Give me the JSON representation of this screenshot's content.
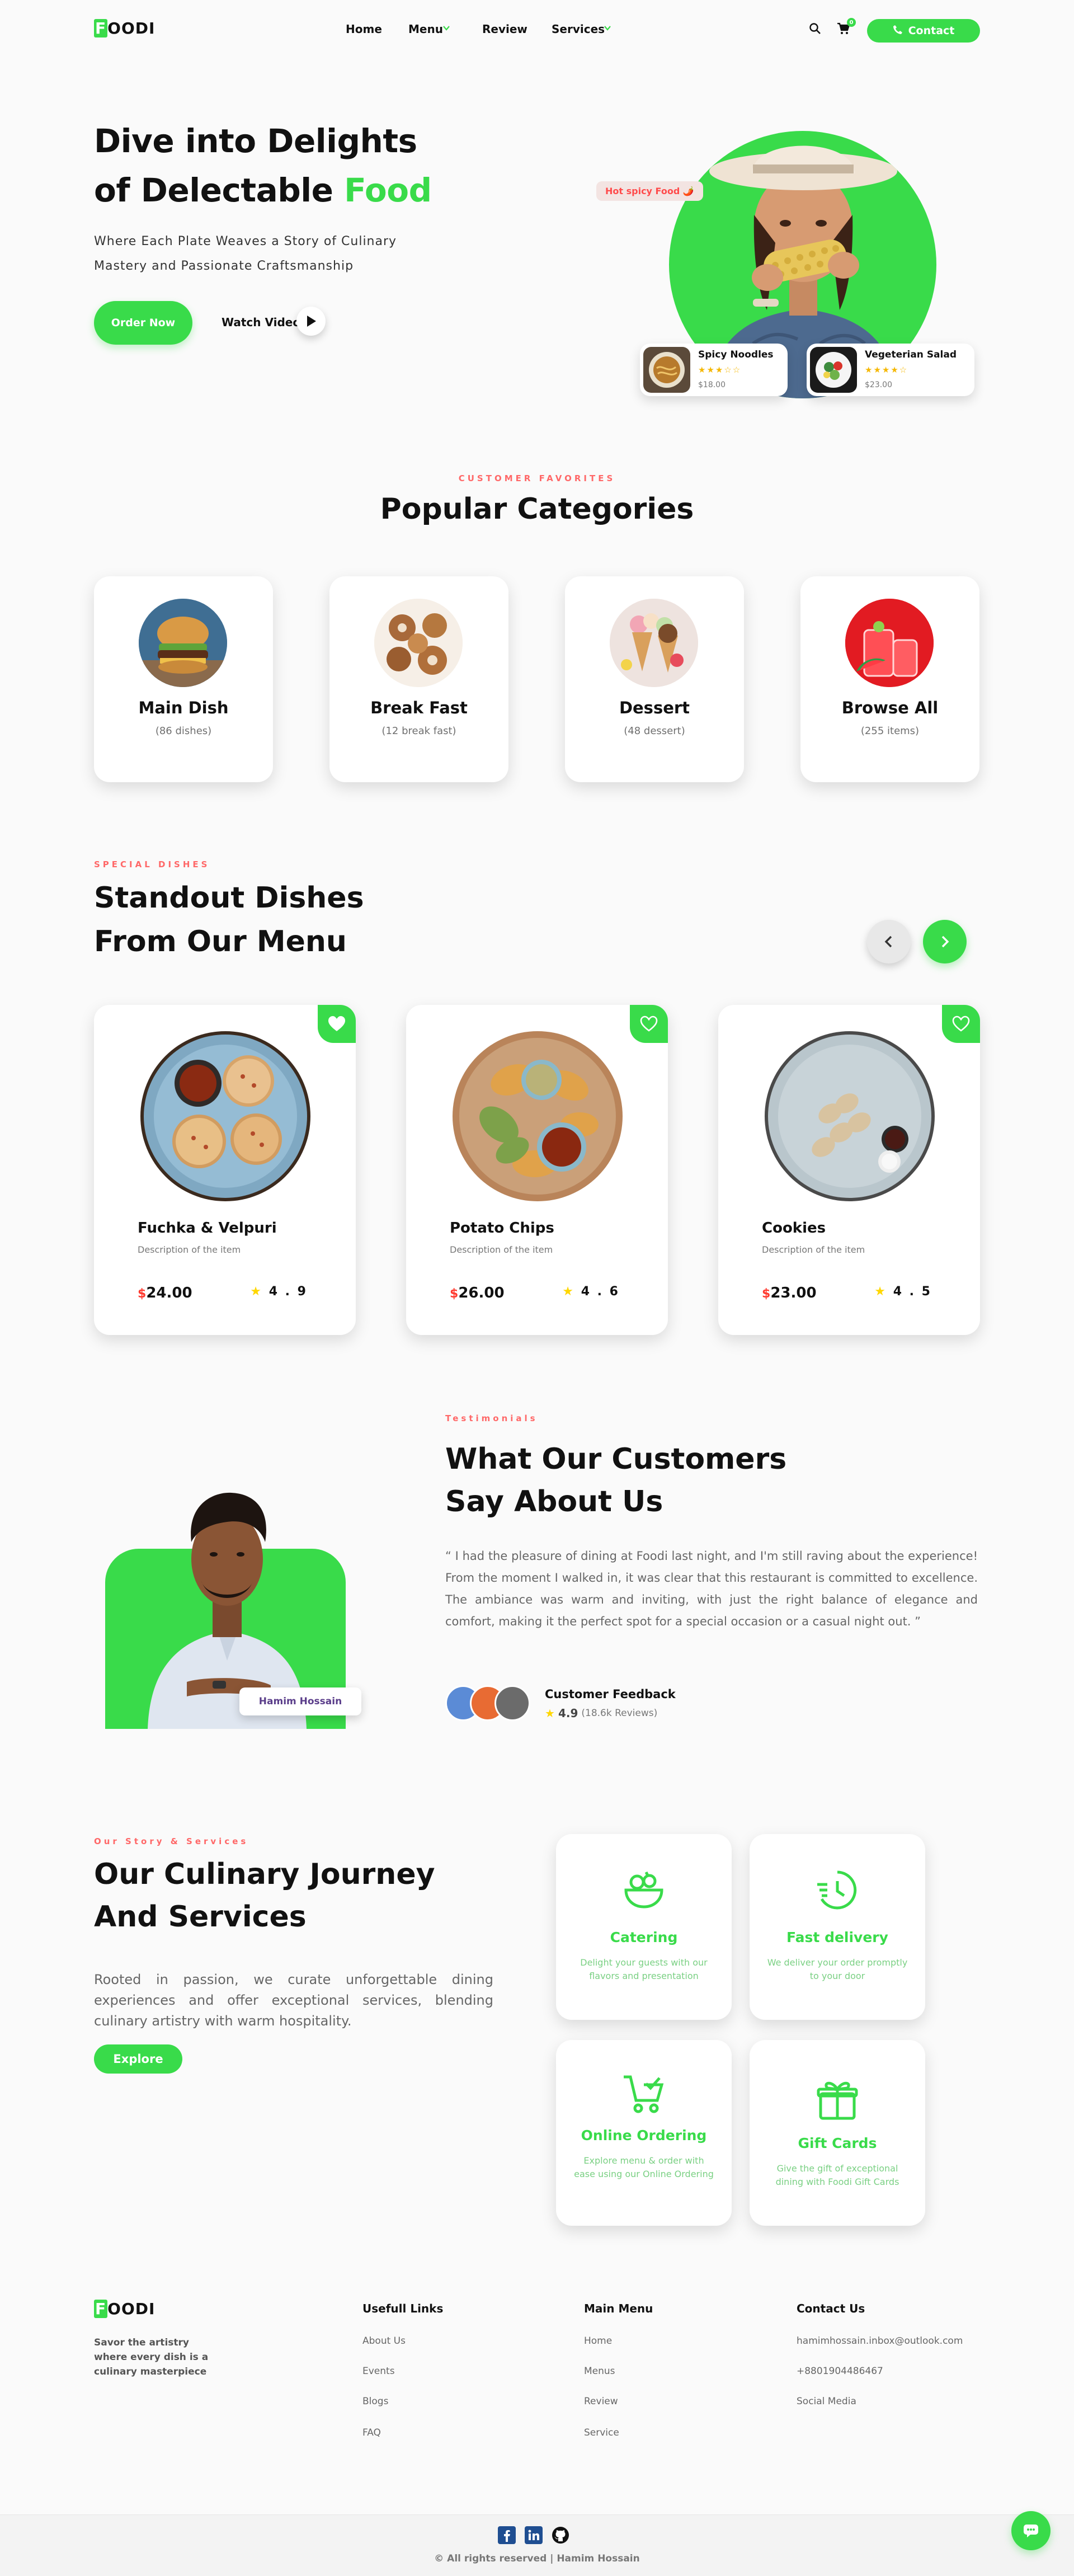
{
  "header": {
    "logo_first": "F",
    "logo_rest": "OODI",
    "nav": [
      "Home",
      "Menu",
      "Review",
      "Services"
    ],
    "cart_count": "0",
    "contact_label": "Contact"
  },
  "hero": {
    "title_line1": "Dive into Delights",
    "title_line2": "of Delectable ",
    "title_accent": "Food",
    "subtitle_line1": "Where Each Plate Weaves a Story of Culinary",
    "subtitle_line2": "Mastery and Passionate Craftsmanship",
    "order_label": "Order Now",
    "watch_label": "Watch Video",
    "spicy_tag": "Hot spicy Food 🌶️",
    "mini_cards": [
      {
        "name": "Spicy Noodles",
        "price": "$18.00",
        "stars": "★★★☆☆"
      },
      {
        "name": "Vegeterian Salad",
        "price": "$23.00",
        "stars": "★★★★☆"
      }
    ]
  },
  "categories": {
    "subtitle": "Customer Favorites",
    "title": "Popular Categories",
    "items": [
      {
        "title": "Main Dish",
        "count": "(86 dishes)"
      },
      {
        "title": "Break Fast",
        "count": "(12 break fast)"
      },
      {
        "title": "Dessert",
        "count": "(48 dessert)"
      },
      {
        "title": "Browse All",
        "count": "(255 items)"
      }
    ]
  },
  "special": {
    "subtitle": "Special Dishes",
    "title_line1": "Standout Dishes",
    "title_line2": "From Our Menu",
    "dishes": [
      {
        "name": "Fuchka & Velpuri",
        "desc": "Description of the item",
        "price_sym": "$",
        "price": "24.00",
        "rating": "4 . 9"
      },
      {
        "name": "Potato Chips",
        "desc": "Description of the item",
        "price_sym": "$",
        "price": "26.00",
        "rating": "4 . 6"
      },
      {
        "name": "Cookies",
        "desc": "Description of the item",
        "price_sym": "$",
        "price": "23.00",
        "rating": "4 . 5"
      }
    ]
  },
  "testimonials": {
    "subtitle": "Testimonials",
    "title_line1": "What Our Customers",
    "title_line2": "Say About Us",
    "quote": "“ I had the pleasure of dining at Foodi last night, and I'm still raving about the experience! From the moment I walked in, it was clear that this restaurant is committed to excellence. The ambiance was warm and inviting, with just the right balance of elegance and comfort, making it the perfect spot for a special occasion or a casual night out. ”",
    "person_name": "Hamim Hossain",
    "feedback_label": "Customer Feedback",
    "rating": "4.9",
    "reviews": "(18.6k Reviews)"
  },
  "services": {
    "subtitle": "Our Story & Services",
    "title_line1": "Our Culinary Journey",
    "title_line2": "And Services",
    "desc": "Rooted in passion, we curate unforgettable dining experiences and offer exceptional services, blending culinary artistry with warm hospitality.",
    "explore_label": "Explore",
    "items": [
      {
        "title": "Catering",
        "desc": "Delight your guests with our flavors and presentation"
      },
      {
        "title": "Fast delivery",
        "desc": "We deliver your order promptly to your door"
      },
      {
        "title": "Online Ordering",
        "desc": "Explore menu & order with ease using our Online Ordering"
      },
      {
        "title": "Gift Cards",
        "desc": "Give the gift of exceptional dining with Foodi Gift Cards"
      }
    ]
  },
  "footer": {
    "tagline": "Savor the artistry where every dish is a culinary masterpiece",
    "col1_title": "Usefull Links",
    "col1": [
      "About Us",
      "Events",
      "Blogs",
      "FAQ"
    ],
    "col2_title": "Main Menu",
    "col2": [
      "Home",
      "Menus",
      "Review",
      "Service"
    ],
    "col3_title": "Contact Us",
    "col3": [
      "hamimhossain.inbox@outlook.com",
      "+8801904486467",
      "Social Media"
    ],
    "copyright": "© All rights reserved | Hamim Hossain"
  },
  "colors": {
    "brand": "#39db4a",
    "accent": "#ff6868",
    "dark": "#111111"
  }
}
